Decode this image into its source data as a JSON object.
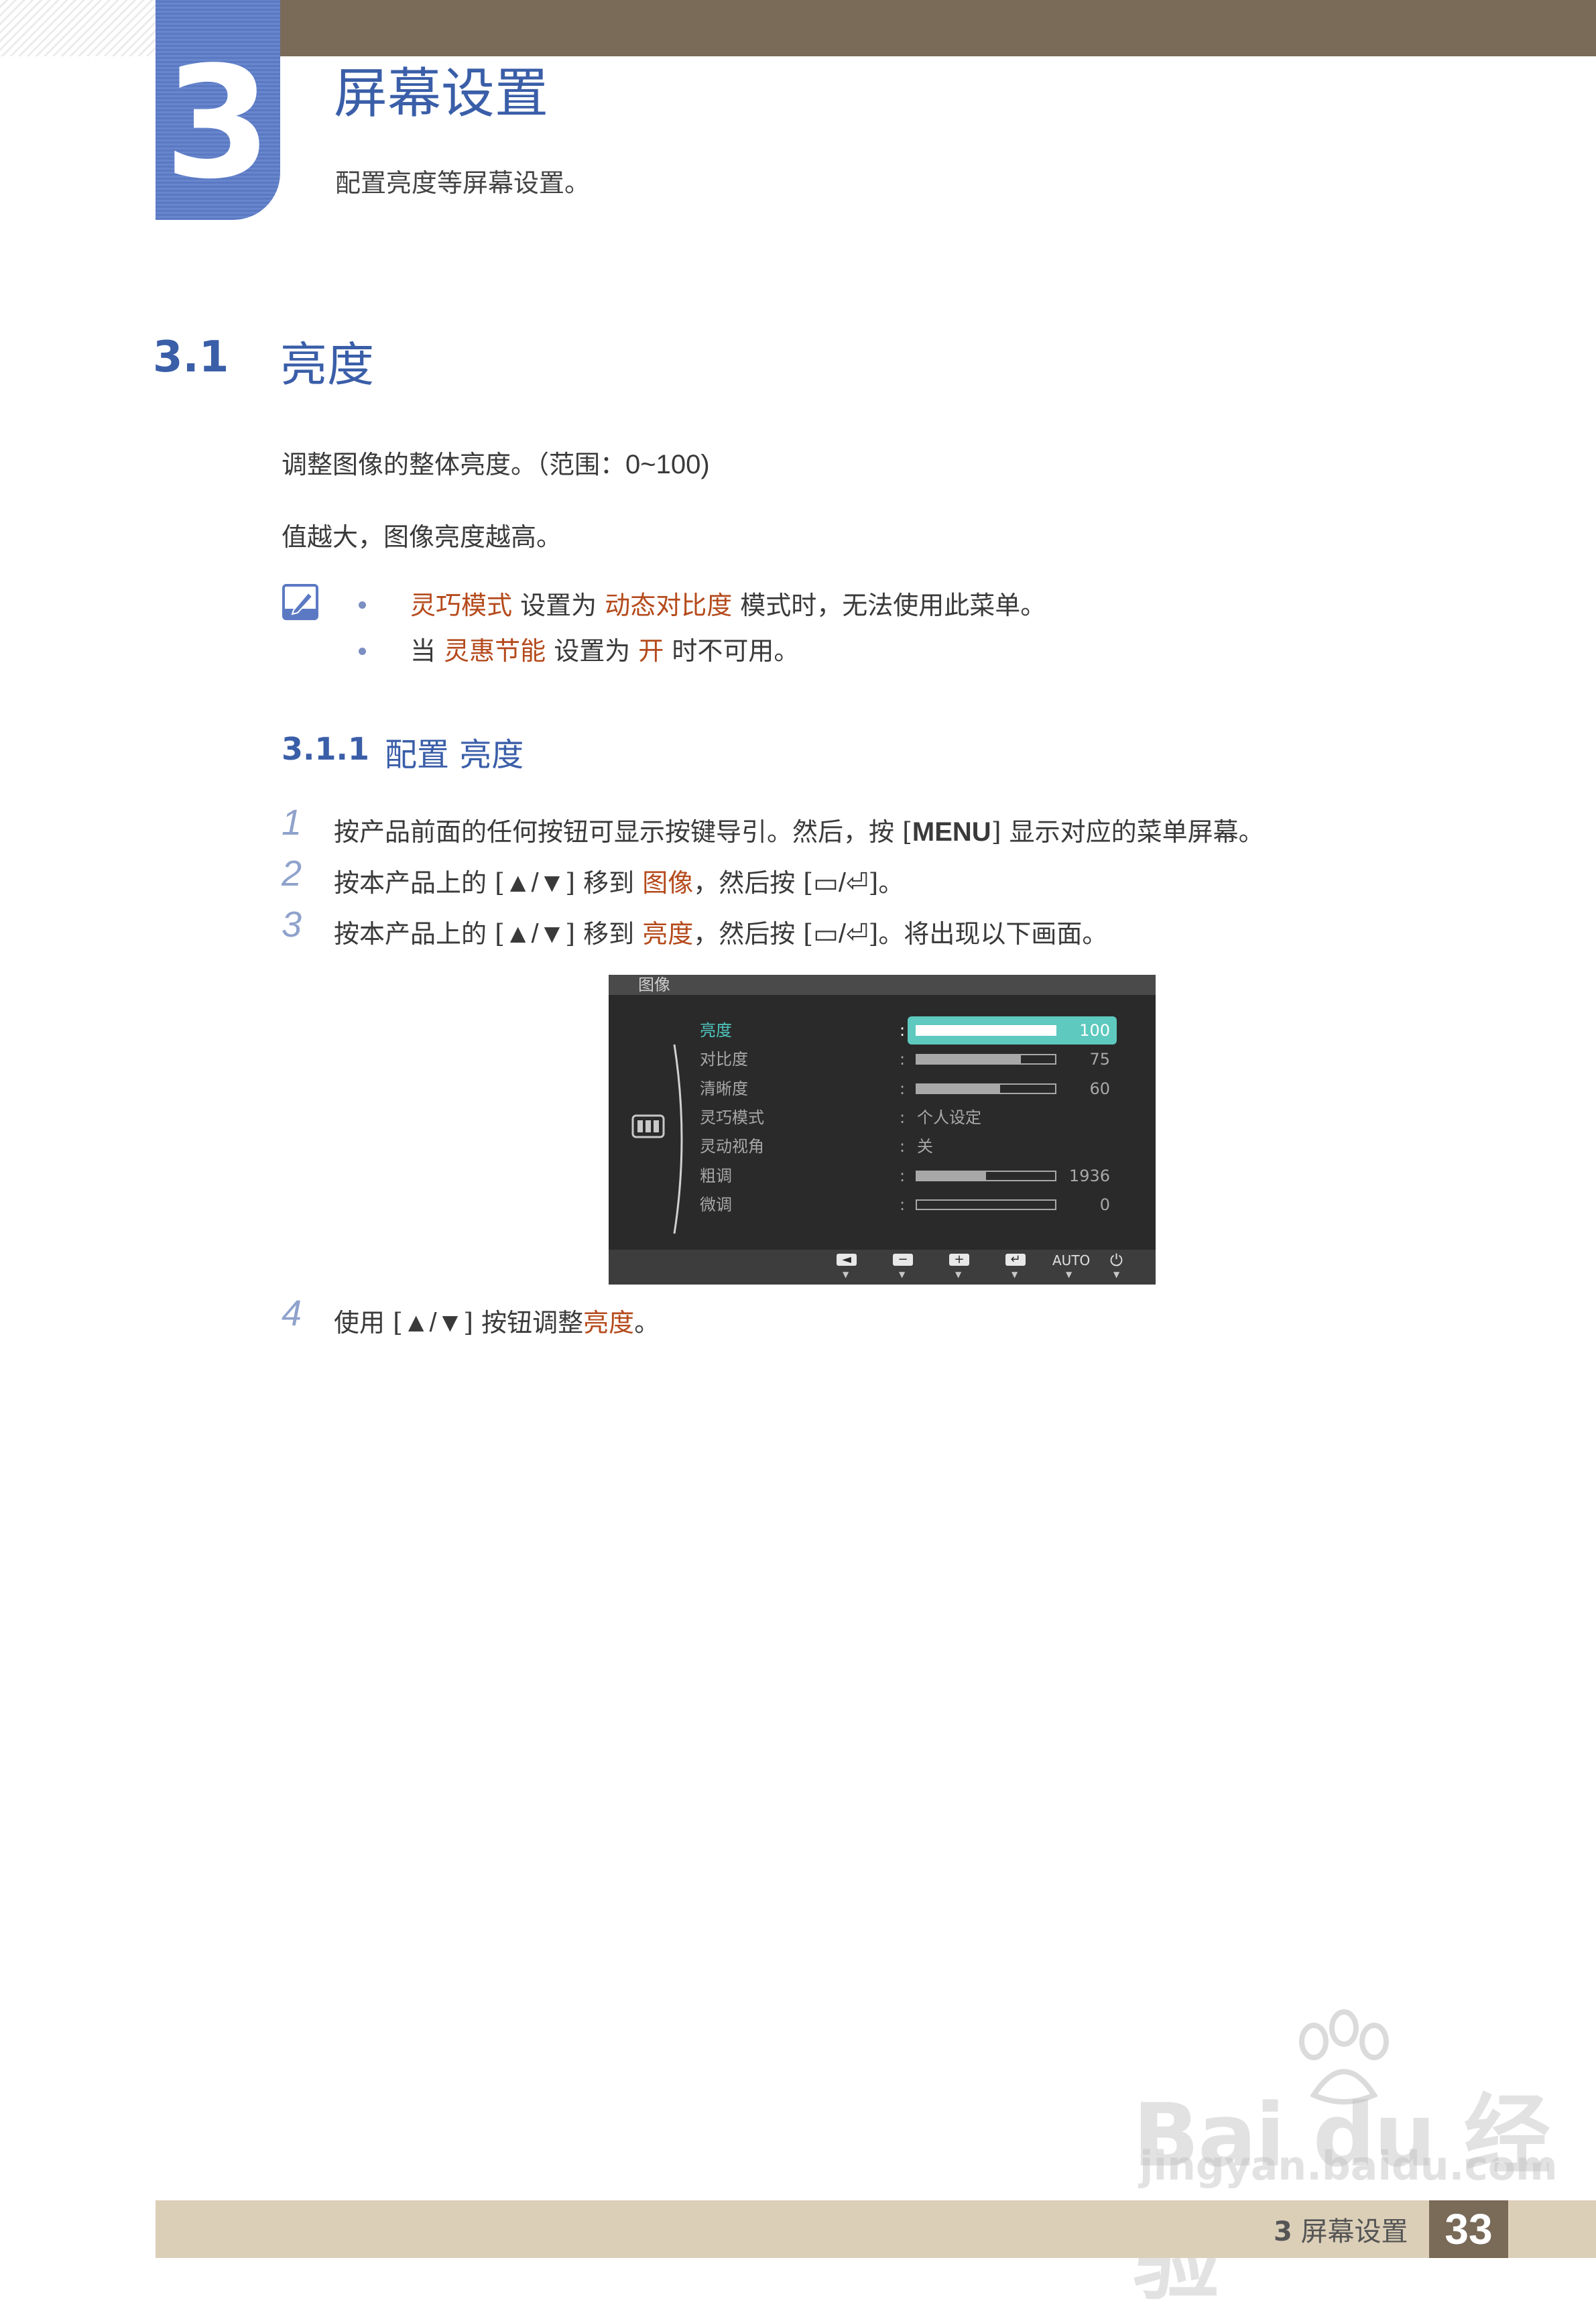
{
  "chapter": {
    "number": "3",
    "title": "屏幕设置",
    "subtitle": "配置亮度等屏幕设置。"
  },
  "section": {
    "number": "3.1",
    "title": "亮度",
    "para1_text": "调整图像的整体亮度。（范围：",
    "para1_range": "0~100)",
    "para2": "值越大，图像亮度越高。"
  },
  "notes": [
    {
      "hl1": "灵巧模式",
      "t1": " 设置为 ",
      "hl2": "动态对比度",
      "t2": " 模式时，无法使用此菜单。"
    },
    {
      "t0": "当 ",
      "hl1": "灵惠节能",
      "t1": " 设置为 ",
      "hl2": "开",
      "t2": " 时不可用。"
    }
  ],
  "subsection": {
    "number": "3.1.1",
    "title": "配置 亮度"
  },
  "steps": [
    {
      "num": "1",
      "a": "按产品前面的任何按钮可显示按键导引。然后，按 [",
      "key": "MENU",
      "b": "] 显示对应的菜单屏幕。"
    },
    {
      "num": "2",
      "a": "按本产品上的 [",
      "key": "▲/▼",
      "b": "] 移到 ",
      "hl": "图像",
      "c": "，然后按 [",
      "key2": "▭/⏎",
      "d": "]。"
    },
    {
      "num": "3",
      "a": "按本产品上的 [",
      "key": "▲/▼",
      "b": "] 移到 ",
      "hl": "亮度",
      "c": "，然后按 [",
      "key2": "▭/⏎",
      "d": "]。将出现以下画面。"
    },
    {
      "num": "4",
      "a": "使用 [",
      "key": "▲/▼",
      "b": "] 按钮调整",
      "hl": "亮度",
      "c": "。"
    }
  ],
  "osd": {
    "title": "图像",
    "rows": [
      {
        "label": "亮度",
        "type": "bar",
        "value": "100",
        "level": 1.0,
        "active": true
      },
      {
        "label": "对比度",
        "type": "bar",
        "value": "75",
        "level": 0.75
      },
      {
        "label": "清晰度",
        "type": "bar",
        "value": "60",
        "level": 0.6
      },
      {
        "label": "灵巧模式",
        "type": "text",
        "value": "个人设定"
      },
      {
        "label": "灵动视角",
        "type": "text",
        "value": "关"
      },
      {
        "label": "粗调",
        "type": "bar",
        "value": "1936",
        "level": 0.5
      },
      {
        "label": "微调",
        "type": "bar",
        "value": "0",
        "level": 0.0
      }
    ],
    "colon": ":",
    "buttons": [
      "◄",
      "−",
      "+",
      "↵"
    ],
    "auto_label": "AUTO",
    "power_glyph": "⏻",
    "arrow_glyph": "▼"
  },
  "footer": {
    "chapter_num": "3",
    "chapter_title": "屏幕设置",
    "page_number": "33"
  },
  "watermark": {
    "logo": "Bai du 经验",
    "url": "jingyan.baidu.com"
  },
  "colors": {
    "accent_blue": "#3a5ea8",
    "highlight_orange": "#b54a1c",
    "header_brown": "#7a6a58",
    "footer_tan": "#dccfb8",
    "osd_teal": "#5ec9bf"
  }
}
